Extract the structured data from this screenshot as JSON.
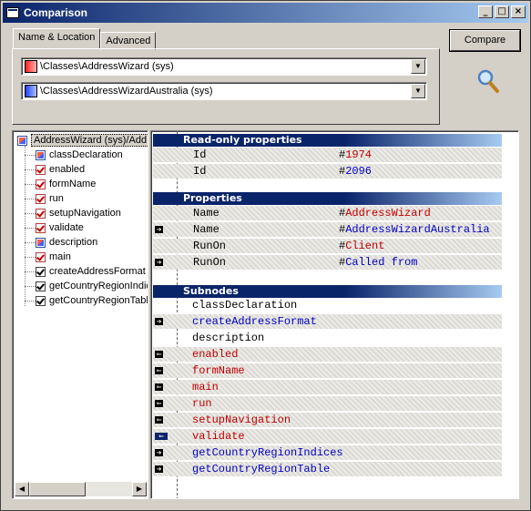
{
  "window": {
    "title": "Comparison",
    "controls": {
      "minimize": "_",
      "maximize": "□",
      "close": "×"
    }
  },
  "tabs": [
    {
      "label": "Name & Location",
      "active": true
    },
    {
      "label": "Advanced",
      "active": false
    }
  ],
  "selectors": [
    {
      "value": "\\Classes\\AddressWizard (sys)",
      "color": "#ff2020"
    },
    {
      "value": "\\Classes\\AddressWizardAustralia (sys)",
      "color": "#2040ff"
    }
  ],
  "compare_button": "Compare",
  "tree": {
    "root": "AddressWizard (sys)/Add",
    "items": [
      {
        "label": "classDeclaration",
        "state": "mixed"
      },
      {
        "label": "enabled",
        "state": "red"
      },
      {
        "label": "formName",
        "state": "red"
      },
      {
        "label": "run",
        "state": "red"
      },
      {
        "label": "setupNavigation",
        "state": "red"
      },
      {
        "label": "validate",
        "state": "red"
      },
      {
        "label": "description",
        "state": "mixed"
      },
      {
        "label": "main",
        "state": "red"
      },
      {
        "label": "createAddressFormat",
        "state": "blue"
      },
      {
        "label": "getCountryRegionIndices",
        "state": "blue"
      },
      {
        "label": "getCountryRegionTable",
        "state": "blue"
      }
    ]
  },
  "detail": {
    "readonly_header": "Read-only properties",
    "readonly": [
      {
        "name": "Id",
        "hash": "#",
        "value": "1974",
        "color": "red"
      },
      {
        "name": "Id",
        "hash": "#",
        "value": "2096",
        "color": "blue"
      }
    ],
    "properties_header": "Properties",
    "properties": [
      {
        "name": "Name",
        "hash": "#",
        "value": "AddressWizard",
        "color": "red",
        "arrow": ""
      },
      {
        "name": "Name",
        "hash": "#",
        "value": "AddressWizardAustralia",
        "color": "blue",
        "arrow": "right"
      },
      {
        "name": "RunOn",
        "hash": "#",
        "value": "Client",
        "color": "red",
        "arrow": ""
      },
      {
        "name": "RunOn",
        "hash": "#",
        "value": "Called from",
        "color": "blue",
        "arrow": "right"
      }
    ],
    "subnodes_header": "Subnodes",
    "subnodes": [
      {
        "name": "classDeclaration",
        "color": "black",
        "arrow": "",
        "shade": false
      },
      {
        "name": "createAddressFormat",
        "color": "blue",
        "arrow": "right",
        "shade": true
      },
      {
        "name": "description",
        "color": "black",
        "arrow": "",
        "shade": false
      },
      {
        "name": "enabled",
        "color": "red",
        "arrow": "left",
        "shade": true
      },
      {
        "name": "formName",
        "color": "red",
        "arrow": "left",
        "shade": true
      },
      {
        "name": "main",
        "color": "red",
        "arrow": "left",
        "shade": true
      },
      {
        "name": "run",
        "color": "red",
        "arrow": "left",
        "shade": true
      },
      {
        "name": "setupNavigation",
        "color": "red",
        "arrow": "left",
        "shade": true
      },
      {
        "name": "validate",
        "color": "red",
        "arrow": "left-selected",
        "shade": true
      },
      {
        "name": "getCountryRegionIndices",
        "color": "blue",
        "arrow": "right",
        "shade": true
      },
      {
        "name": "getCountryRegionTable",
        "color": "blue",
        "arrow": "right",
        "shade": true
      }
    ]
  }
}
